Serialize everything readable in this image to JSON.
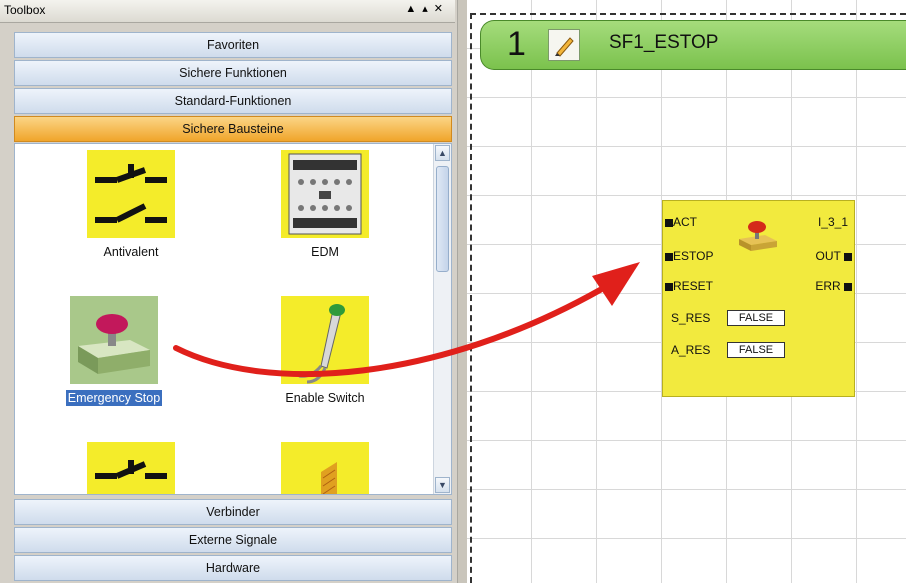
{
  "toolbox": {
    "title": "Toolbox",
    "categories_top": [
      "Favoriten",
      "Sichere Funktionen",
      "Standard-Funktionen",
      "Sichere Bausteine"
    ],
    "active_category": "Sichere Bausteine",
    "items": [
      "Antivalent",
      "EDM",
      "Emergency Stop",
      "Enable Switch"
    ],
    "selected_item": "Emergency Stop",
    "categories_bottom": [
      "Verbinder",
      "Externe Signale",
      "Hardware"
    ]
  },
  "network": {
    "number": "1",
    "name": "SF1_ESTOP"
  },
  "function_block": {
    "instance": "I_3_1",
    "inputs": [
      "ACT",
      "ESTOP",
      "RESET"
    ],
    "outputs": [
      "OUT",
      "ERR"
    ],
    "params": [
      {
        "name": "S_RES",
        "value": "FALSE"
      },
      {
        "name": "A_RES",
        "value": "FALSE"
      }
    ]
  },
  "colors": {
    "active_tab": "#f0a52b",
    "block_yellow": "#f2ea3e",
    "banner_green": "#7bc24d",
    "arrow_red": "#e0201b"
  }
}
